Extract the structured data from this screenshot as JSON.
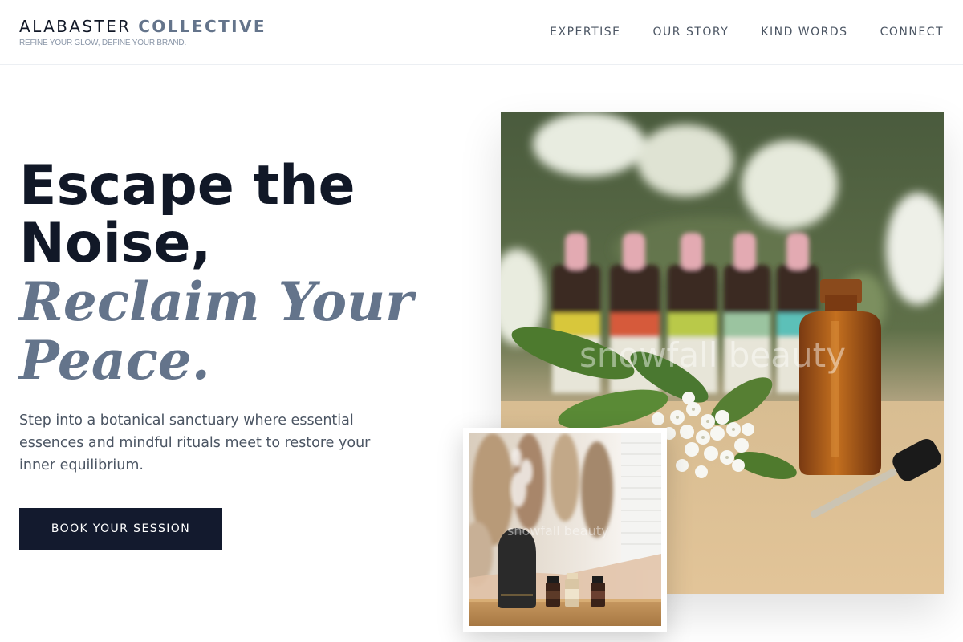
{
  "brand": {
    "name_part1": "ALABASTER",
    "name_part2": "COLLECTIVE",
    "tagline": "REFINE YOUR GLOW, DEFINE YOUR BRAND."
  },
  "nav": {
    "items": [
      {
        "label": "EXPERTISE"
      },
      {
        "label": "OUR STORY"
      },
      {
        "label": "KIND WORDS"
      },
      {
        "label": "CONNECT"
      }
    ]
  },
  "hero": {
    "title_line1": "Escape the",
    "title_line2": "Noise,",
    "italic_line1": "Reclaim Your",
    "italic_line2": "Peace.",
    "subtitle": "Step into a botanical sanctuary where essential essences and mindful rituals meet to restore your inner equilibrium.",
    "cta_label": "BOOK YOUR SESSION"
  },
  "images": {
    "main_watermark": "snowfall beauty",
    "small_watermark": "snowfall beauty"
  },
  "colors": {
    "dark": "#111827",
    "accent_slate": "#64748b",
    "button": "#131a2e",
    "body_text": "#4b5563"
  }
}
